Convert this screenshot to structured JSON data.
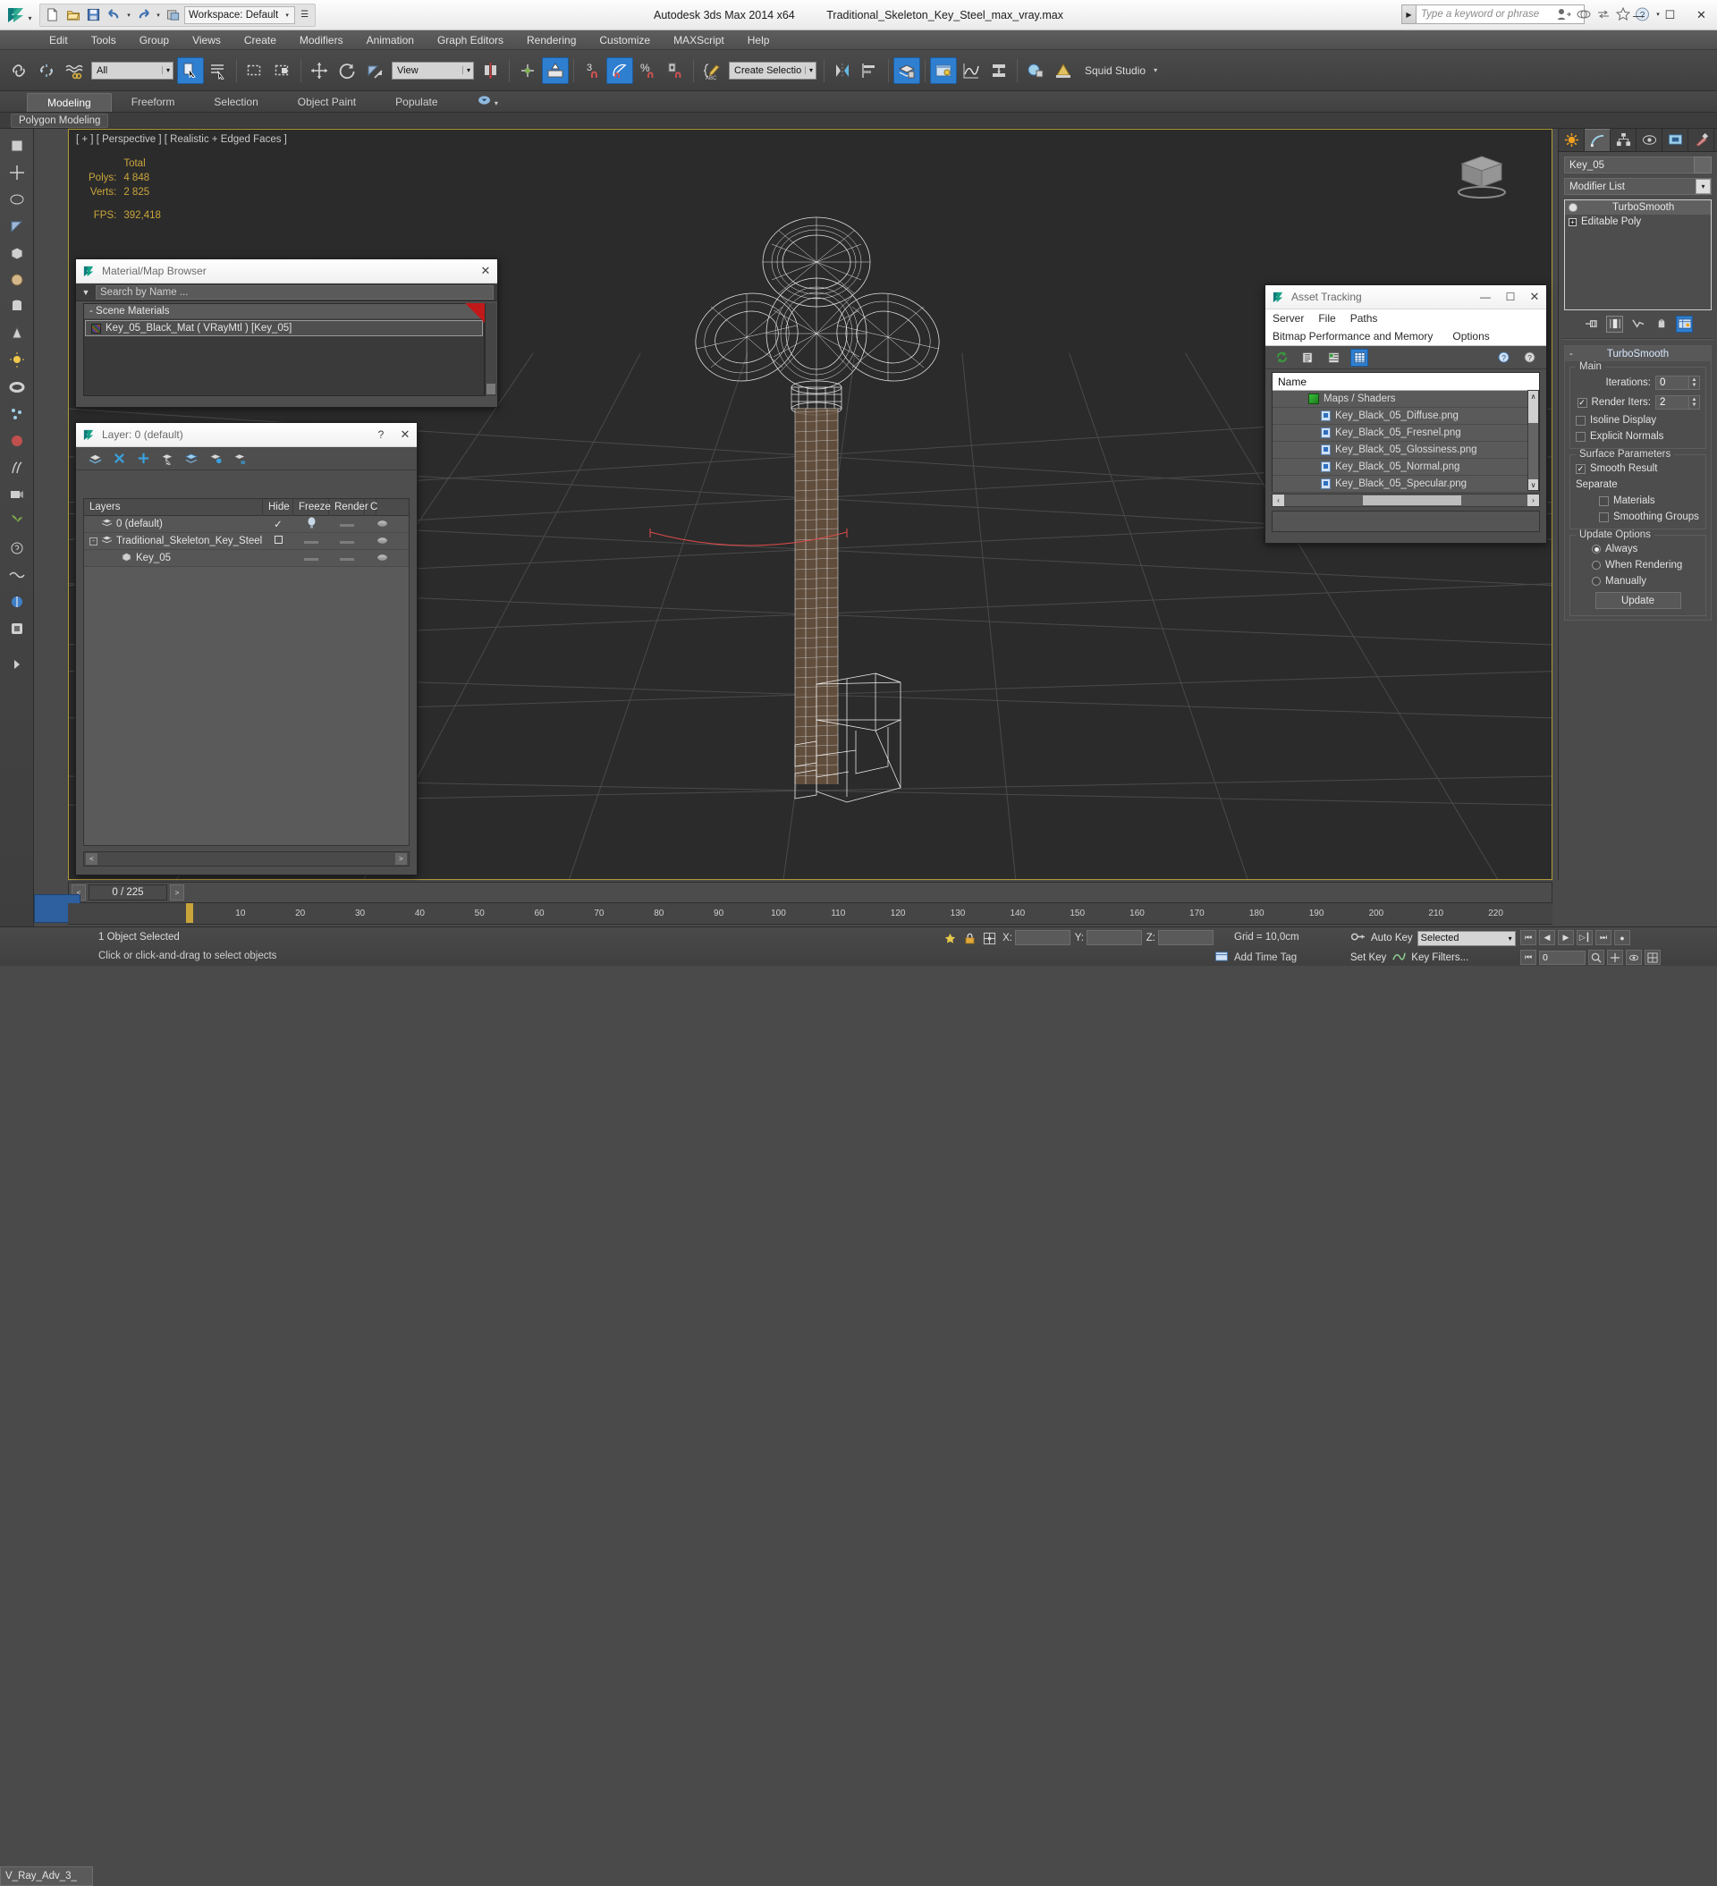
{
  "app": {
    "product_title": "Autodesk 3ds Max  2014 x64",
    "file_title": "Traditional_Skeleton_Key_Steel_max_vray.max",
    "workspace_label": "Workspace: Default",
    "search_placeholder": "Type a keyword or phrase"
  },
  "window_controls": {
    "minimize": "—",
    "maximize": "☐",
    "close": "✕"
  },
  "menu": {
    "items": [
      "Edit",
      "Tools",
      "Group",
      "Views",
      "Create",
      "Modifiers",
      "Animation",
      "Graph Editors",
      "Rendering",
      "Customize",
      "MAXScript",
      "Help"
    ]
  },
  "main_toolbar": {
    "selection_filter": "All",
    "reference_coord": "View",
    "named_selection_set": "Create Selection Se",
    "snap_number": "3",
    "percent_symbol": "%",
    "workspace_right": "Squid Studio",
    "workspace_caret": "⌄"
  },
  "ribbon": {
    "tabs": [
      "Modeling",
      "Freeform",
      "Selection",
      "Object Paint",
      "Populate"
    ],
    "active_tab": "Modeling",
    "panel_label": "Polygon Modeling"
  },
  "viewport": {
    "label": "[ + ] [ Perspective ] [ Realistic + Edged Faces ]",
    "stats": {
      "column_header": "Total",
      "rows": [
        {
          "label": "Polys:",
          "value": "4 848"
        },
        {
          "label": "Verts:",
          "value": "2 825"
        }
      ],
      "fps_label": "FPS:",
      "fps_value": "392,418"
    }
  },
  "material_browser": {
    "title": "Material/Map Browser",
    "search_placeholder": "Search by Name ...",
    "group_label": "- Scene Materials",
    "items": [
      {
        "name": "Key_05_Black_Mat  ( VRayMtl )  [Key_05]"
      }
    ],
    "close": "✕"
  },
  "layer_dialog": {
    "title": "Layer: 0 (default)",
    "help": "?",
    "close": "✕",
    "columns": [
      "Layers",
      "Hide",
      "Freeze",
      "Render",
      "C"
    ],
    "rows": [
      {
        "name": "0 (default)",
        "indent": 0,
        "current": "✓",
        "hide": "bulb",
        "freeze": "dash",
        "render": "teapot"
      },
      {
        "name": "Traditional_Skeleton_Key_Steel",
        "indent": 0,
        "current": "box",
        "hide": "dash",
        "freeze": "dash",
        "render": "teapot"
      },
      {
        "name": "Key_05",
        "indent": 1,
        "current": "",
        "hide": "dash",
        "freeze": "dash",
        "render": "teapot"
      }
    ],
    "scroll_left": "<",
    "scroll_right": ">"
  },
  "asset_tracking": {
    "title": "Asset Tracking",
    "minimize": "—",
    "maximize": "☐",
    "close": "✕",
    "menu_row1": [
      "Server",
      "File",
      "Paths"
    ],
    "menu_row2": [
      "Bitmap Performance and Memory",
      "Options"
    ],
    "column_header": "Name",
    "group": "Maps / Shaders",
    "assets": [
      "Key_Black_05_Diffuse.png",
      "Key_Black_05_Fresnel.png",
      "Key_Black_05_Glossiness.png",
      "Key_Black_05_Normal.png",
      "Key_Black_05_Specular.png"
    ],
    "scroll_up": "∧",
    "scroll_down": "∨",
    "scroll_left": "‹",
    "scroll_right": "›"
  },
  "command_panel": {
    "object_name": "Key_05",
    "modifier_list_label": "Modifier List",
    "modifier_stack": [
      {
        "label": "TurboSmooth",
        "selected": true
      },
      {
        "label": "Editable Poly",
        "selected": false
      }
    ],
    "rollout": {
      "title": "TurboSmooth",
      "collapse": "-",
      "groups": [
        {
          "label": "Main",
          "fields": [
            {
              "type": "spinner",
              "label": "Iterations:",
              "value": "0"
            },
            {
              "type": "checkbox_spinner",
              "label": "Render Iters:",
              "value": "2",
              "checked": true
            },
            {
              "type": "checkbox",
              "label": "Isoline Display",
              "checked": false
            },
            {
              "type": "checkbox",
              "label": "Explicit Normals",
              "checked": false
            }
          ]
        },
        {
          "label": "Surface Parameters",
          "fields": [
            {
              "type": "checkbox",
              "label": "Smooth Result",
              "checked": true
            },
            {
              "type": "text",
              "label": "Separate"
            },
            {
              "type": "checkbox",
              "label": "Materials",
              "checked": false,
              "indent": true
            },
            {
              "type": "checkbox",
              "label": "Smoothing Groups",
              "checked": false,
              "indent": true
            }
          ]
        },
        {
          "label": "Update Options",
          "fields": [
            {
              "type": "radio",
              "label": "Always",
              "checked": true
            },
            {
              "type": "radio",
              "label": "When Rendering",
              "checked": false
            },
            {
              "type": "radio",
              "label": "Manually",
              "checked": false
            },
            {
              "type": "button",
              "label": "Update"
            }
          ]
        }
      ]
    }
  },
  "timeline": {
    "frame_readout": "0 / 225",
    "prev": "<",
    "next": ">",
    "ticks": [
      "10",
      "20",
      "30",
      "40",
      "50",
      "60",
      "70",
      "80",
      "90",
      "100",
      "110",
      "120",
      "130",
      "140",
      "150",
      "160",
      "170",
      "180",
      "190",
      "200",
      "210",
      "220"
    ]
  },
  "status_bar": {
    "selection_info": "1 Object Selected",
    "prompt": "Click or click-and-drag to select objects",
    "x_label": "X:",
    "y_label": "Y:",
    "z_label": "Z:",
    "x_value": "",
    "y_value": "",
    "z_value": "",
    "grid_text": "Grid = 10,0cm",
    "auto_key": "Auto Key",
    "selected_combo": "Selected",
    "set_key": "Set Key",
    "key_filters": "Key Filters...",
    "add_time_tag": "Add Time Tag",
    "frame_field": "0",
    "vray_tab": "V_Ray_Adv_3_"
  },
  "colors": {
    "accent_blue": "#2f7fd1",
    "viewport_bg": "#2b2b2b",
    "viewport_border": "#b09a3a",
    "stats_yellow": "#c9a63b",
    "panel_gray": "#4b4b4b",
    "titlebar_light": "#f4f4f4",
    "material_red": "#c01919"
  }
}
